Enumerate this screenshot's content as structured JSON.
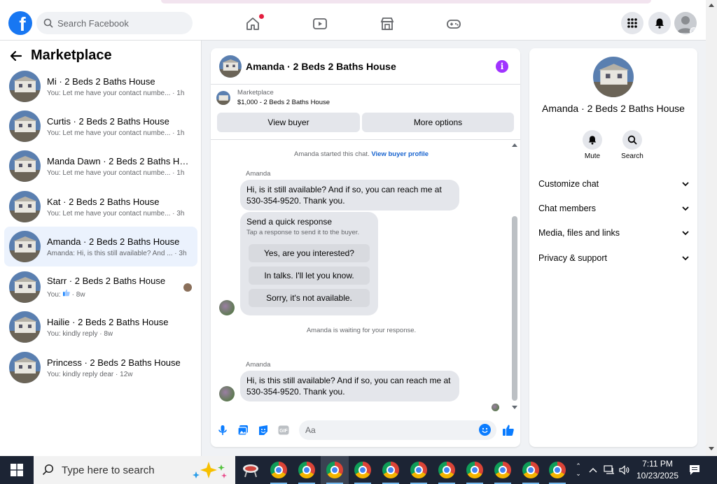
{
  "topbar": {
    "search_placeholder": "Search Facebook",
    "brand_color": "#1877f2"
  },
  "left": {
    "title": "Marketplace",
    "conversations": [
      {
        "name": "Mi · 2 Beds 2 Baths House",
        "snippet": "You: Let me have your contact numbe... · 1h"
      },
      {
        "name": "Curtis · 2 Beds 2 Baths House",
        "snippet": "You: Let me have your contact numbe... · 1h"
      },
      {
        "name": "Manda Dawn · 2 Beds 2 Baths Hou...",
        "snippet": "You: Let me have your contact numbe... · 1h"
      },
      {
        "name": "Kat · 2 Beds 2 Baths House",
        "snippet": "You: Let me have your contact numbe... · 3h"
      },
      {
        "name": "Amanda · 2 Beds 2 Baths House",
        "snippet": "Amanda: Hi, is this still available? And ... · 3h"
      },
      {
        "name": "Starr · 2 Beds 2 Baths House",
        "snippet_prefix": "You:",
        "snippet_suffix": "· 8w"
      },
      {
        "name": "Hailie · 2 Beds 2 Baths House",
        "snippet": "You: kindly reply · 8w"
      },
      {
        "name": "Princess · 2 Beds 2 Baths House",
        "snippet": "You: kindly reply dear · 12w"
      }
    ]
  },
  "chat": {
    "title": "Amanda · 2 Beds 2 Baths House",
    "marketplace_label": "Marketplace",
    "listing": "$1,000 - 2 Beds 2 Baths House",
    "view_buyer": "View buyer",
    "more_options": "More options",
    "started_text": "Amanda started this chat.",
    "view_profile_link": "View buyer profile",
    "sender1": "Amanda",
    "message1": "Hi, is it still available? And if so, you can reach me at 530-354-9520. Thank you.",
    "quick_title": "Send a quick response",
    "quick_sub": "Tap a response to send it to the buyer.",
    "quick_options": [
      "Yes, are you interested?",
      "In talks. I'll let you know.",
      "Sorry, it's not available."
    ],
    "waiting_text": "Amanda is waiting for your response.",
    "sender2": "Amanda",
    "message2": "Hi, is this still available? And if so, you can reach me at 530-354-9520. Thank you.",
    "input_placeholder": "Aa",
    "accent_color": "#0a7cff"
  },
  "details": {
    "title": "Amanda · 2 Beds 2 Baths House",
    "mute": "Mute",
    "search": "Search",
    "sections": [
      "Customize chat",
      "Chat members",
      "Media, files and links",
      "Privacy & support"
    ]
  },
  "taskbar": {
    "search_placeholder": "Type here to search",
    "time": "7:11 PM",
    "date": "10/23/2025"
  }
}
